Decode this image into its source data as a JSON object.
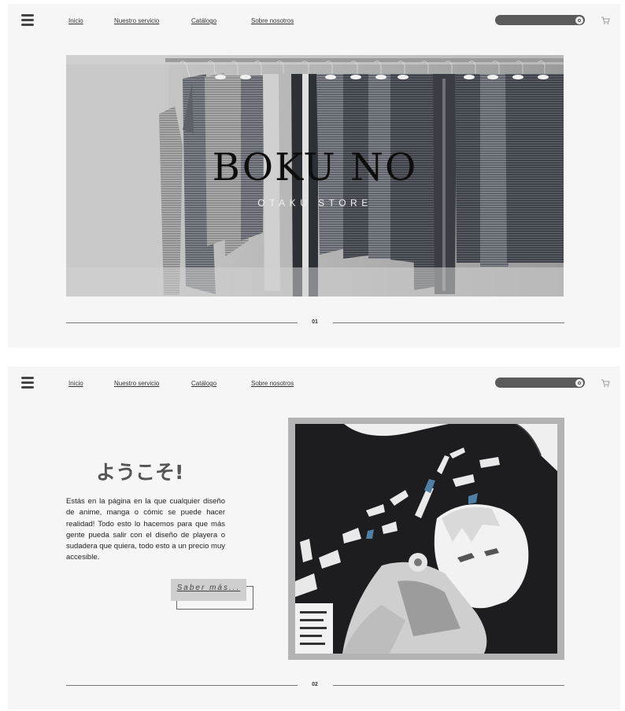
{
  "nav": {
    "links": [
      "Inicio",
      "Nuestro servicio",
      "Catálogo",
      "Sobre nosotros"
    ]
  },
  "search": {
    "placeholder": ""
  },
  "icons": {
    "menu": "hamburger-menu-icon",
    "search": "search-icon",
    "cart": "shopping-cart-icon"
  },
  "hero": {
    "title": "BOKU NO",
    "subtitle": "OTAKU STORE",
    "page_number": "01"
  },
  "welcome": {
    "heading": "ようこそ!",
    "description": "Estás en la página en la que cualquier diseño de anime, manga o cómic se puede hacer realidad! Todo esto lo hacemos para que más gente pueda salir con el diseño de playera o sudadera que quiera, todo esto a un precio muy accesible.",
    "button_label": "Saber más...",
    "page_number": "02"
  },
  "colors": {
    "background": "#f7f6f7",
    "search_bar": "#5a5a5a",
    "button": "#cfcfcf",
    "frame": "#b3b3b3"
  }
}
